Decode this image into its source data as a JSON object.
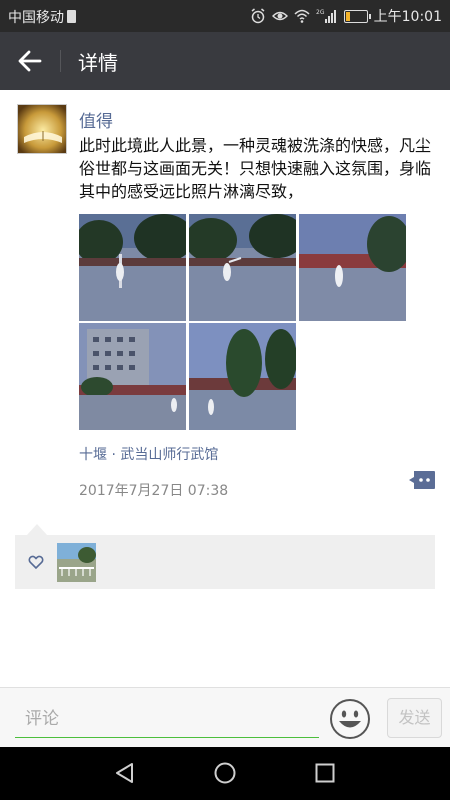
{
  "status_bar": {
    "carrier": "中国移动",
    "network_badge": "2G",
    "time": "上午10:01",
    "icons": [
      "alarm-icon",
      "eye-icon",
      "wifi-icon",
      "signal-icon",
      "battery-icon"
    ],
    "battery_color": "#f2b32b"
  },
  "app_bar": {
    "back_icon": "arrow-left-icon",
    "title": "详情"
  },
  "post": {
    "username": "值得",
    "text": "此时此境此人此景，一种灵魂被洗涤的快感，凡尘俗世都与这画面无关！只想快速融入这氛围，身临其中的感受远比照片淋漓尽致，",
    "photos": [
      "photo-tai-chi-trees-1",
      "photo-tai-chi-trees-2",
      "photo-tai-chi-red-wall",
      "photo-building",
      "photo-tai-chi-pine"
    ],
    "location": "十堰 · 武当山师行武馆",
    "timestamp": "2017年7月27日 07:38",
    "more_icon": "comment-dots-icon"
  },
  "likes": {
    "heart_icon": "heart-outline-icon",
    "liker_count": 1
  },
  "comment_bar": {
    "placeholder": "评论",
    "value": "",
    "emoji_icon": "smiley-icon",
    "send_label": "发送"
  },
  "nav_bar": {
    "icons": [
      "back-triangle-icon",
      "home-circle-icon",
      "recents-square-icon"
    ]
  },
  "colors": {
    "link_blue": "#576b95",
    "accent_green": "#4cbf3c",
    "app_bar": "#393a3f"
  }
}
